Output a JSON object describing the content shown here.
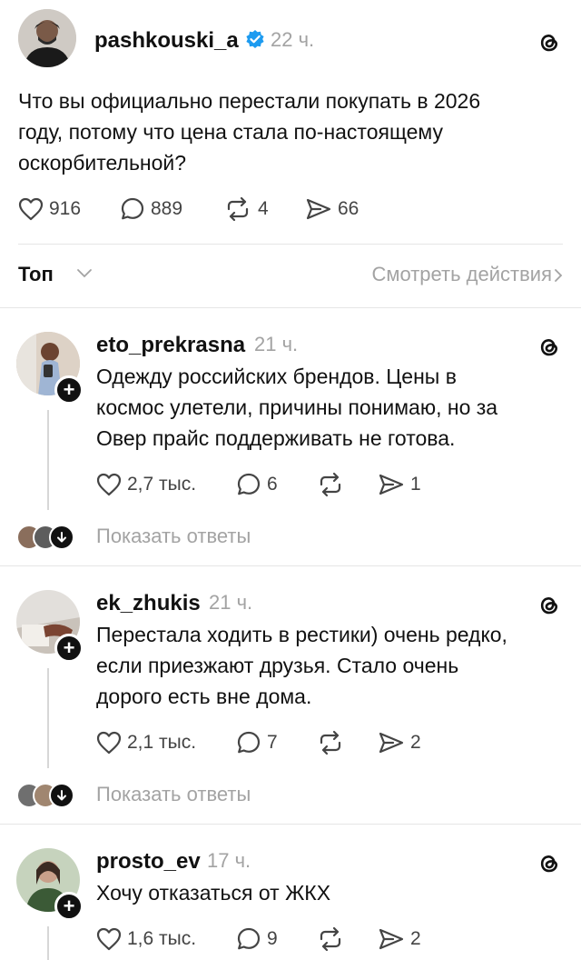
{
  "main_post": {
    "username": "pashkouski_a",
    "time": "22 ч.",
    "text_lines": [
      "Что вы официально перестали покупать в 2026",
      "году, потому что цена стала по-настоящему",
      "оскорбительной?"
    ],
    "likes": "916",
    "replies": "889",
    "reposts": "4",
    "shares": "66"
  },
  "sort": {
    "label": "Топ",
    "activity_link": "Смотреть действия"
  },
  "replies": [
    {
      "username": "eto_prekrasna",
      "time": "21 ч.",
      "text_lines": [
        "Одежду российских брендов. Цены в",
        "космос улетели, причины понимаю, но за",
        "Овер прайс поддерживать не готова."
      ],
      "likes": "2,7 тыс.",
      "replies": "6",
      "shares": "1",
      "show_replies": "Показать ответы"
    },
    {
      "username": "ek_zhukis",
      "time": "21 ч.",
      "text_lines": [
        "Перестала ходить в рестики) очень редко,",
        "если приезжают друзья. Стало очень",
        "дорого есть вне дома."
      ],
      "likes": "2,1 тыс.",
      "replies": "7",
      "shares": "2",
      "show_replies": "Показать ответы"
    },
    {
      "username": "prosto_ev",
      "time": "17 ч.",
      "text_lines": [
        "Хочу отказаться от ЖКХ"
      ],
      "likes": "1,6 тыс.",
      "replies": "9",
      "shares": "2"
    }
  ],
  "colors": {
    "verified": "#1d9bf0",
    "muted": "#a3a3a3",
    "divider": "#e6e6e6"
  },
  "icons": {
    "like": "heart-icon",
    "reply": "comment-icon",
    "repost": "repost-icon",
    "share": "send-icon",
    "brand": "threads-logo-icon",
    "verified": "verified-badge-icon"
  }
}
